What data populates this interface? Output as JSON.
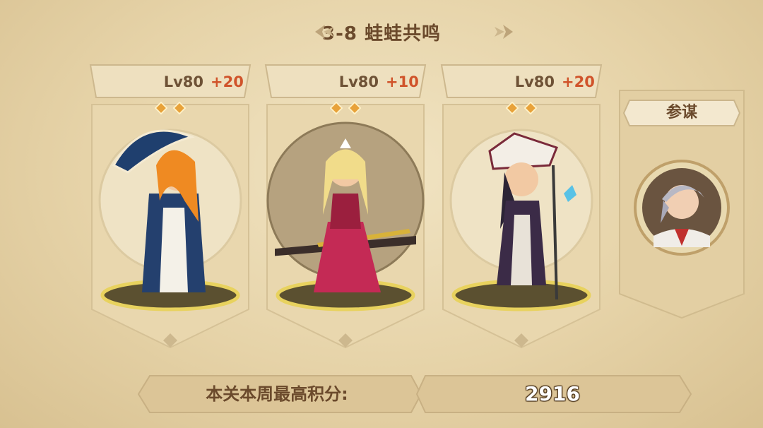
{
  "title": "3-8 蛙蛙共鸣",
  "heroes": [
    {
      "level": "Lv80",
      "bonus": "+20",
      "stars": 2,
      "portrait_icon": "hero-umbrella-lady-figure",
      "accent": "#1f3f6e"
    },
    {
      "level": "Lv80",
      "bonus": "+10",
      "stars": 2,
      "portrait_icon": "hero-blonde-lancer-figure",
      "accent": "#c42a55"
    },
    {
      "level": "Lv80",
      "bonus": "+20",
      "stars": 2,
      "portrait_icon": "hero-pirate-hat-figure",
      "accent": "#3b2b47"
    }
  ],
  "advisor": {
    "label": "参谋",
    "portrait_icon": "advisor-silver-hair-portrait"
  },
  "score": {
    "label": "本关本周最高积分:",
    "value": "2916"
  },
  "colors": {
    "background": "#ead9b2",
    "text_brown": "#6b4a2c",
    "bonus_orange": "#d0532a",
    "gold": "#d7b54c"
  }
}
